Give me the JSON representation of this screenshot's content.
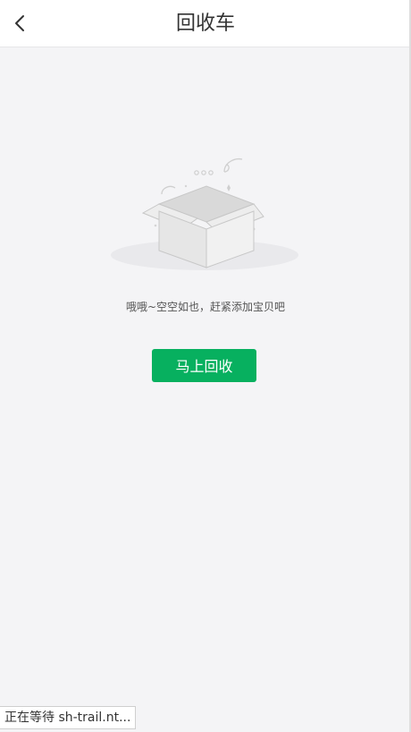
{
  "header": {
    "title": "回收车",
    "back_icon": "chevron-left-icon"
  },
  "empty_state": {
    "illustration": "empty-box-icon",
    "message": "哦哦~空空如也，赶紧添加宝贝吧",
    "button_label": "马上回收"
  },
  "status_bar": {
    "text": "正在等待 sh-trail.nt..."
  },
  "colors": {
    "accent": "#07b05f",
    "background": "#f4f4f6",
    "header_bg": "#ffffff"
  }
}
